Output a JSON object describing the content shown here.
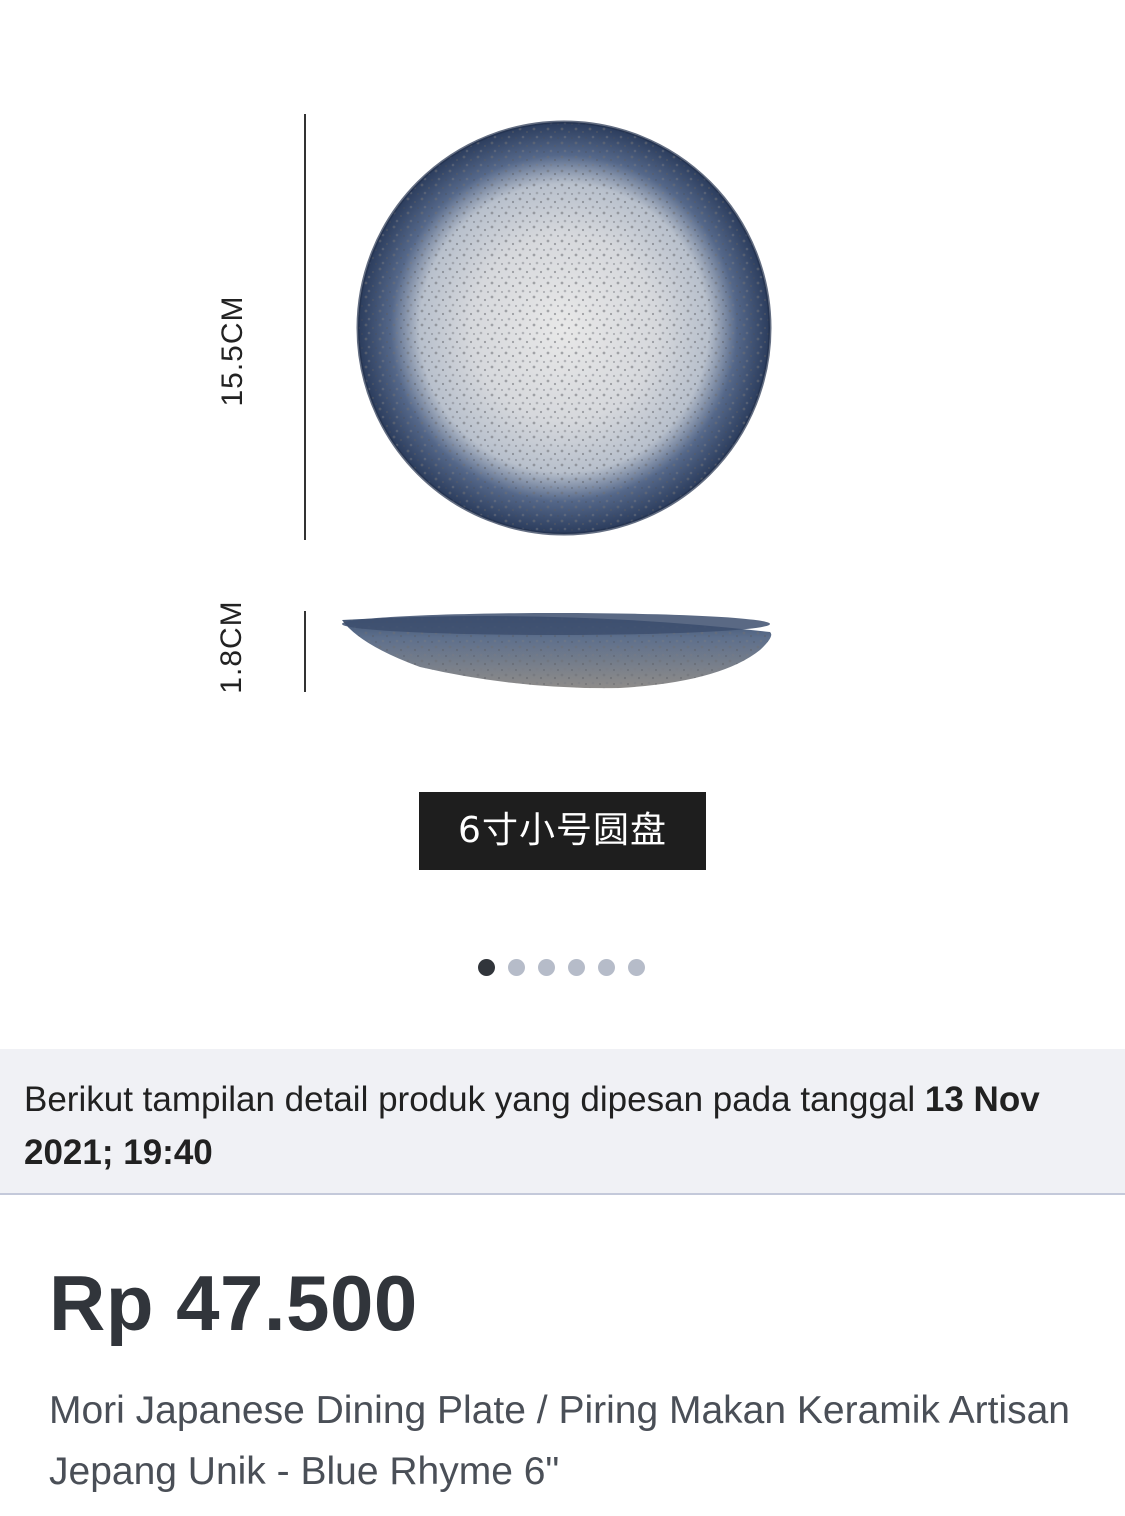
{
  "gallery": {
    "dimension_height": "15.5CM",
    "dimension_depth": "1.8CM",
    "size_tag": "6寸小号圆盘",
    "slide_count": 6,
    "active_slide": 1
  },
  "order_banner": {
    "text": "Berikut tampilan detail produk yang dipesan pada tanggal ",
    "date": "13 Nov 2021; 19:40"
  },
  "product": {
    "price": "Rp 47.500",
    "name": "Mori Japanese Dining Plate / Piring Makan Keramik Artisan Jepang Unik - Blue Rhyme 6\""
  },
  "colors": {
    "text_primary": "#31353b",
    "banner_bg": "#f0f1f5",
    "dot_active": "#31353b",
    "dot_inactive": "#b6bcc9",
    "plate_rim": "#2f4466"
  }
}
